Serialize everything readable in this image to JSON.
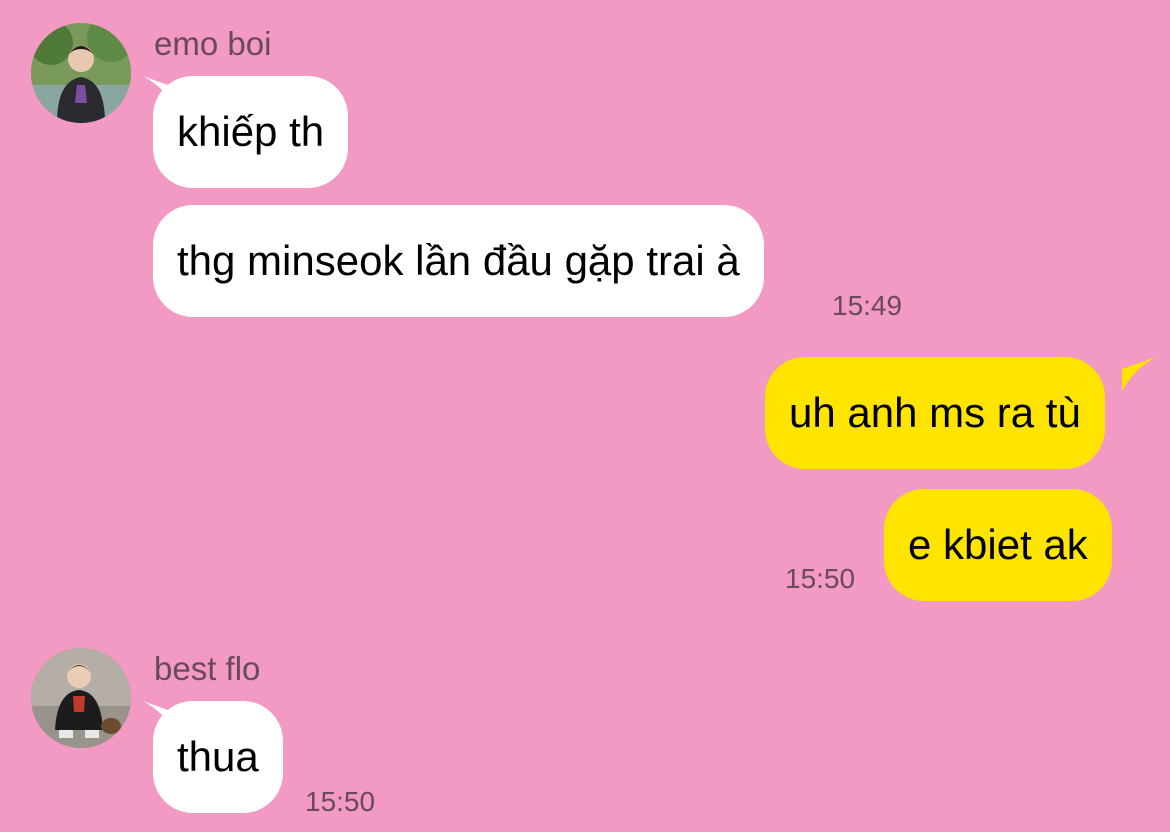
{
  "messages": {
    "g1": {
      "sender": "emo boi",
      "lines": [
        "khiếp th",
        "thg minseok lần đầu gặp trai à"
      ],
      "time": "15:49"
    },
    "g2": {
      "lines": [
        "uh anh ms ra tù",
        "e kbiet ak"
      ],
      "time": "15:50"
    },
    "g3": {
      "sender": "best flo",
      "lines": [
        "thua"
      ],
      "time": "15:50"
    }
  },
  "colors": {
    "background": "#f29ac3",
    "incoming_bubble": "#ffffff",
    "outgoing_bubble": "#ffe400",
    "meta_text": "#6a4a5a"
  }
}
